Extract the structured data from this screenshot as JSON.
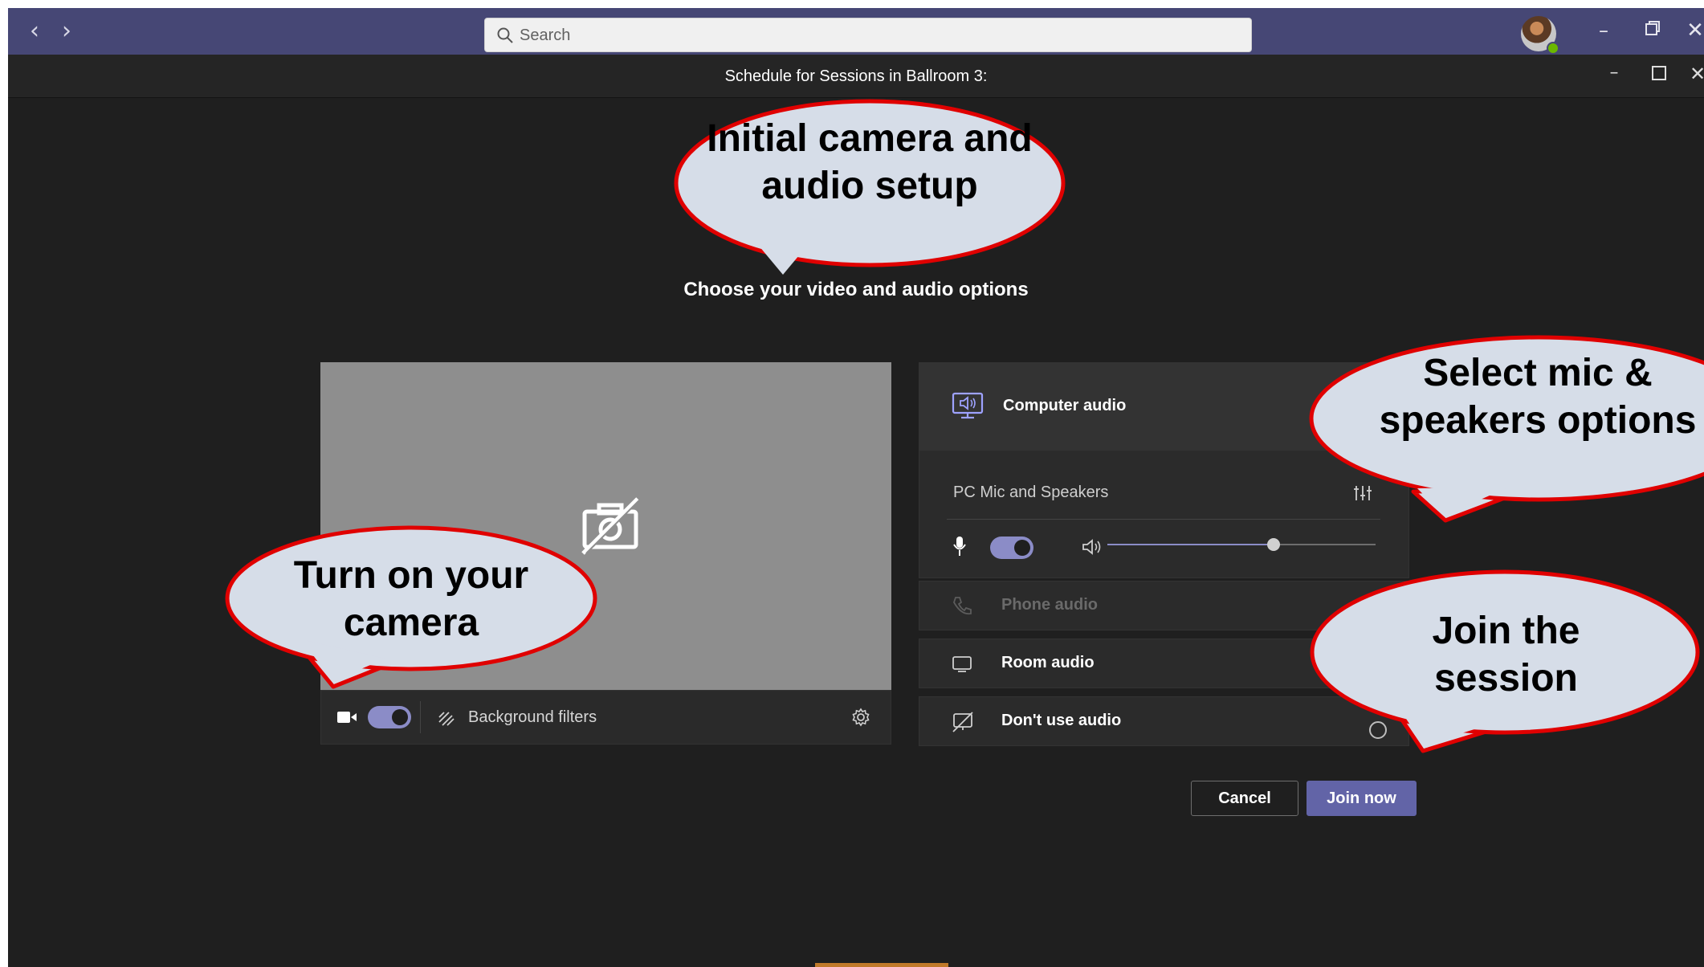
{
  "titlebar": {
    "back_icon": "chevron-left-icon",
    "forward_icon": "chevron-right-icon",
    "search_placeholder": "Search",
    "window_controls": [
      "minimize",
      "restore",
      "close"
    ]
  },
  "meeting": {
    "title": "Schedule for Sessions in Ballroom 3:"
  },
  "prejoin": {
    "heading": "Choose your video and audio options",
    "video": {
      "camera_on": true,
      "background_filters_label": "Background filters",
      "camera_off_icon": "camera-off-icon"
    },
    "audio": {
      "options": [
        {
          "label": "Computer audio",
          "icon": "computer-audio-icon",
          "selected": true
        },
        {
          "label": "Phone audio",
          "icon": "phone-icon",
          "disabled": true
        },
        {
          "label": "Room audio",
          "icon": "room-display-icon"
        },
        {
          "label": "Don't use audio",
          "icon": "no-audio-icon"
        }
      ],
      "device_label": "PC Mic and Speakers",
      "mic_on": true,
      "speaker_volume": 0.62
    },
    "buttons": {
      "cancel": "Cancel",
      "join": "Join now"
    }
  },
  "callouts": [
    {
      "text": "Initial camera and audio setup"
    },
    {
      "text": "Select mic & speakers options"
    },
    {
      "text": "Turn on your camera"
    },
    {
      "text": "Join the session"
    }
  ],
  "colors": {
    "titlebar": "#464775",
    "accent": "#6264a7",
    "toggle": "#8b8cc7",
    "callout_fill": "#d6dde8",
    "callout_border": "#e00000"
  }
}
